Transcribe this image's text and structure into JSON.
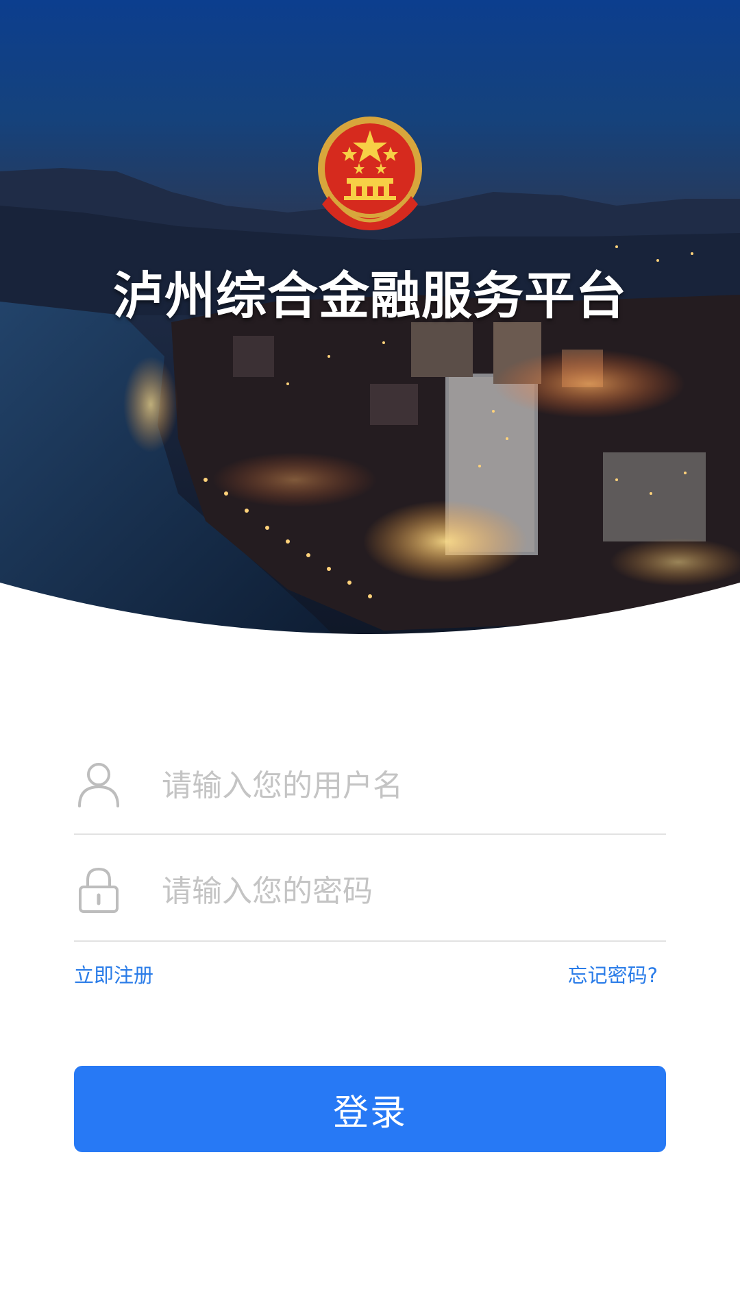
{
  "header": {
    "app_title": "泸州综合金融服务平台",
    "emblem_icon": "national-emblem-icon"
  },
  "login_form": {
    "username": {
      "placeholder": "请输入您的用户名",
      "value": "",
      "icon": "user-icon"
    },
    "password": {
      "placeholder": "请输入您的密码",
      "value": "",
      "icon": "lock-icon"
    },
    "register_link": "立即注册",
    "forgot_link": "忘记密码?",
    "submit_label": "登录"
  },
  "colors": {
    "accent": "#2779f5",
    "link": "#2a7ce8",
    "placeholder": "#c4c4c4",
    "divider": "#e2e2e2"
  }
}
